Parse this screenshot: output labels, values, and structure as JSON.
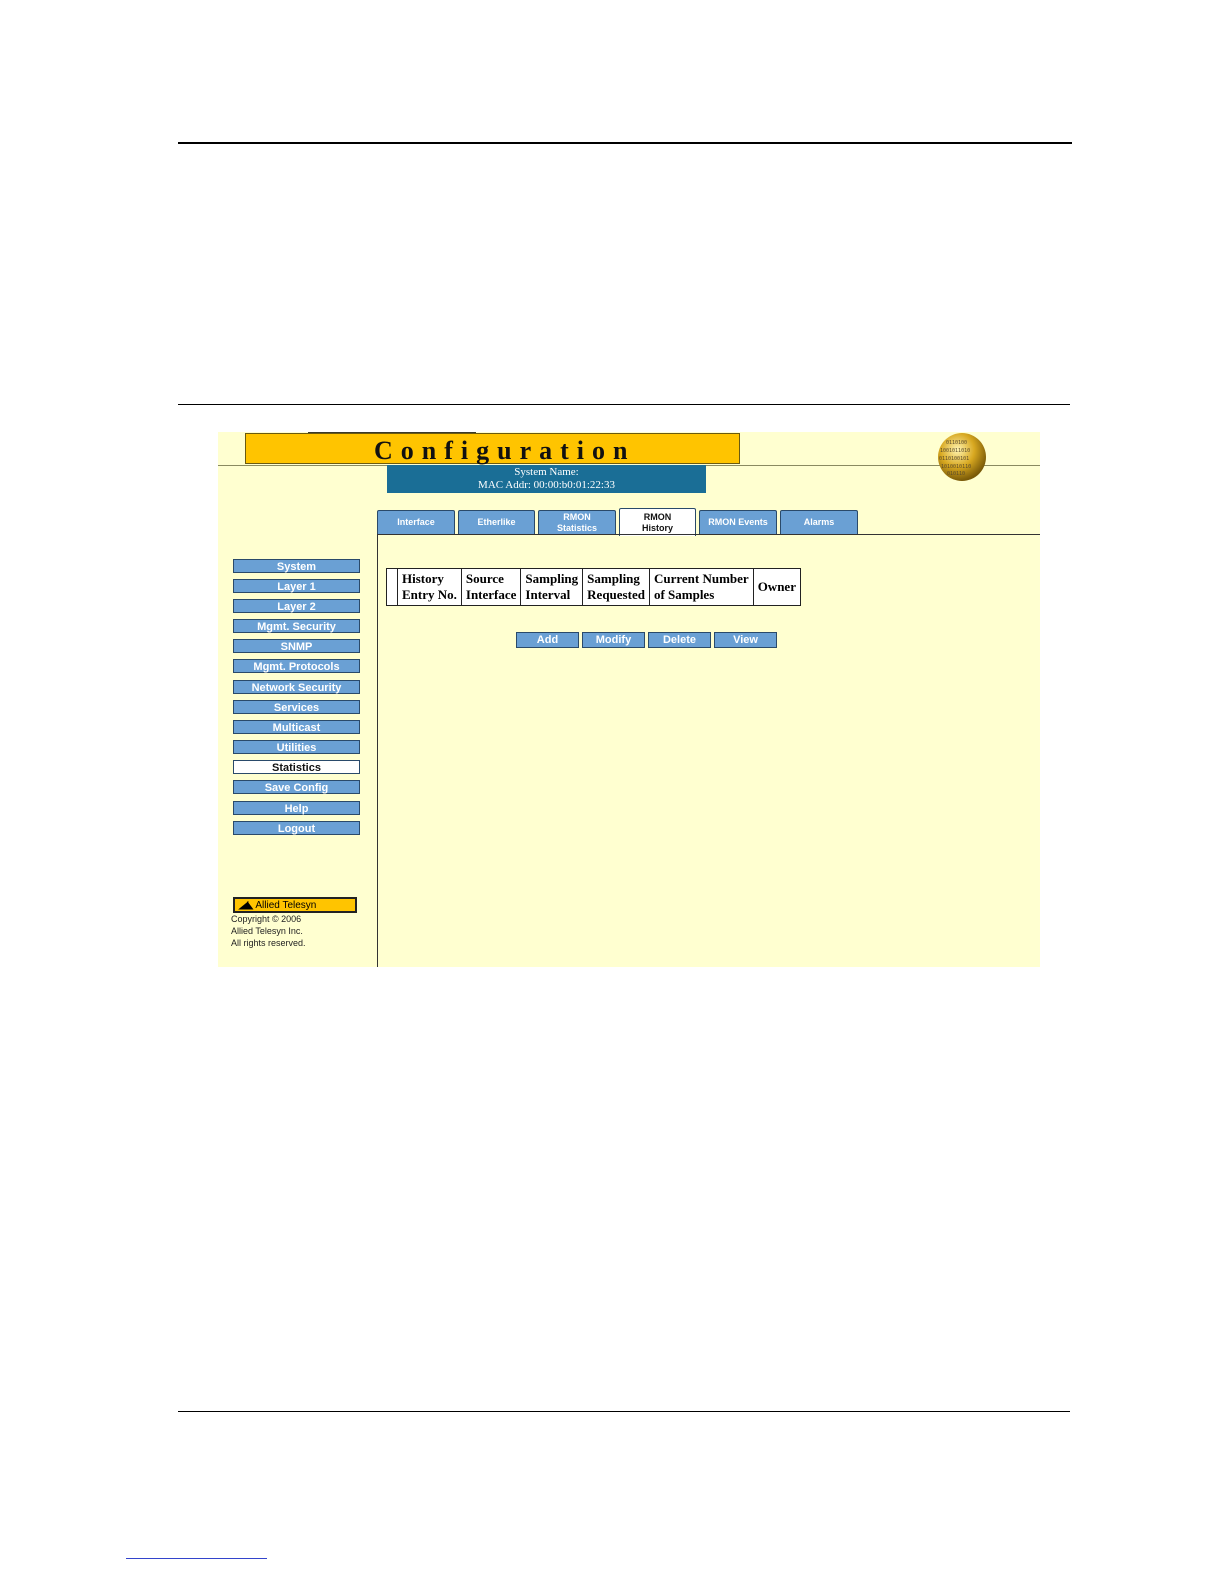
{
  "app": {
    "title": "Configuration",
    "system_name_label": "System Name:",
    "mac_addr_label": "MAC Addr:  00:00:b0:01:22:33"
  },
  "tabs": [
    {
      "label": "Interface",
      "active": false
    },
    {
      "label": "Etherlike",
      "active": false
    },
    {
      "label": "RMON Statistics",
      "active": false
    },
    {
      "label": "RMON History",
      "active": true
    },
    {
      "label": "RMON Events",
      "active": false
    },
    {
      "label": "Alarms",
      "active": false
    }
  ],
  "sidebar": {
    "items": [
      {
        "label": "System"
      },
      {
        "label": "Layer 1"
      },
      {
        "label": "Layer 2"
      },
      {
        "label": "Mgmt. Security"
      },
      {
        "label": "SNMP"
      },
      {
        "label": "Mgmt. Protocols"
      },
      {
        "label": "Network Security"
      },
      {
        "label": "Services"
      },
      {
        "label": "Multicast"
      },
      {
        "label": "Utilities"
      },
      {
        "label": "Statistics",
        "active": true
      },
      {
        "label": "Save Config"
      },
      {
        "label": "Help"
      },
      {
        "label": "Logout"
      }
    ]
  },
  "brand": {
    "logo_text": "Allied Telesyn",
    "copyright_line1": "Copyright © 2006",
    "copyright_line2": "Allied Telesyn Inc.",
    "copyright_line3": "All rights reserved."
  },
  "table": {
    "columns": [
      {
        "line1": "History",
        "line2": "Entry No."
      },
      {
        "line1": "Source",
        "line2": "Interface"
      },
      {
        "line1": "Sampling",
        "line2": "Interval"
      },
      {
        "line1": "Sampling",
        "line2": "Requested"
      },
      {
        "line1": "Current Number",
        "line2": "of Samples"
      },
      {
        "line1": "Owner",
        "line2": ""
      }
    ]
  },
  "actions": {
    "add": "Add",
    "modify": "Modify",
    "delete": "Delete",
    "view": "View"
  },
  "colors": {
    "page_bg": "#ffffd0",
    "title_bar": "#ffc400",
    "sysinfo_bar": "#1a6e96",
    "button": "#6aa0d4"
  }
}
